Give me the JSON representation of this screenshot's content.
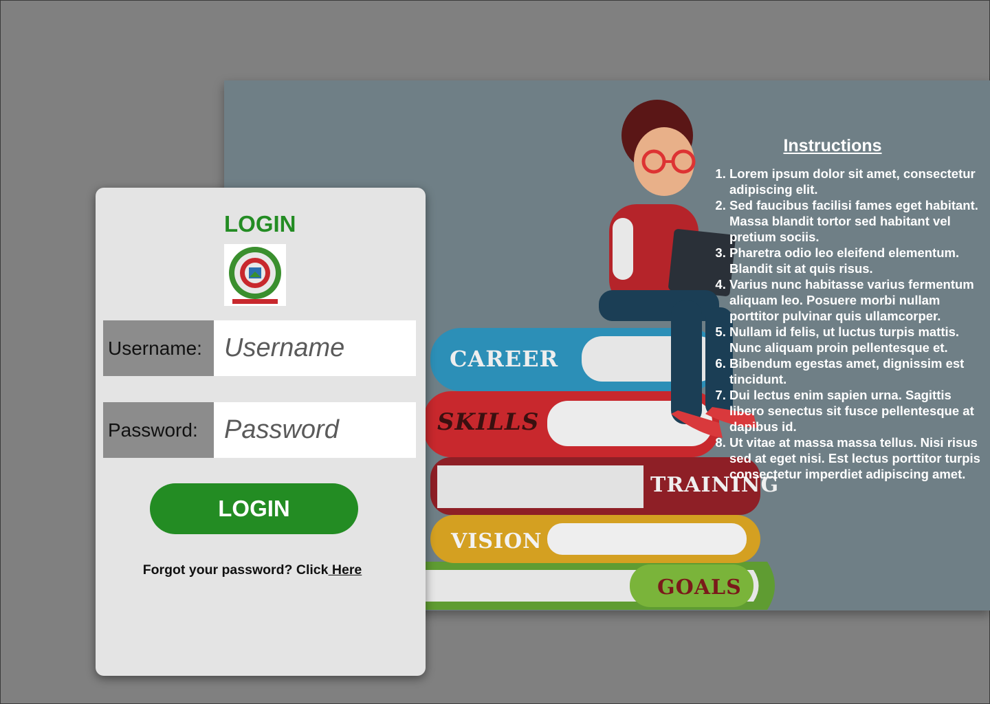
{
  "login": {
    "heading": "LOGIN",
    "username_label": "Username:",
    "username_placeholder": "Username",
    "username_value": "",
    "password_label": "Password:",
    "password_placeholder": "Password",
    "password_value": "",
    "button_label": "LOGIN",
    "forgot_text": "Forgot your password? Click",
    "forgot_link": " Here"
  },
  "hero": {
    "books": [
      "CAREER",
      "SKILLS",
      "TRAINING",
      "VISION",
      "GOALS"
    ]
  },
  "instructions": {
    "title": "Instructions",
    "items": [
      "Lorem ipsum dolor sit amet, consectetur adipiscing elit.",
      " Sed faucibus facilisi fames eget habitant. Massa blandit tortor sed habitant vel pretium sociis.",
      " Pharetra odio leo eleifend elementum. Blandit sit at quis risus.",
      "Varius nunc habitasse varius fermentum aliquam leo. Posuere morbi nullam porttitor pulvinar quis ullamcorper.",
      "Nullam id felis, ut luctus turpis mattis. Nunc aliquam proin pellentesque et.",
      "Bibendum egestas amet, dignissim est tincidunt.",
      "Dui lectus enim sapien urna. Sagittis libero senectus sit fusce pellentesque at dapibus id.",
      " Ut vitae at massa massa tellus. Nisi risus sed at eget nisi. Est lectus porttitor turpis consectetur imperdiet adipiscing amet."
    ]
  },
  "colors": {
    "brand_green": "#238c23",
    "backdrop": "#808080",
    "card_bg": "#e4e4e4"
  }
}
